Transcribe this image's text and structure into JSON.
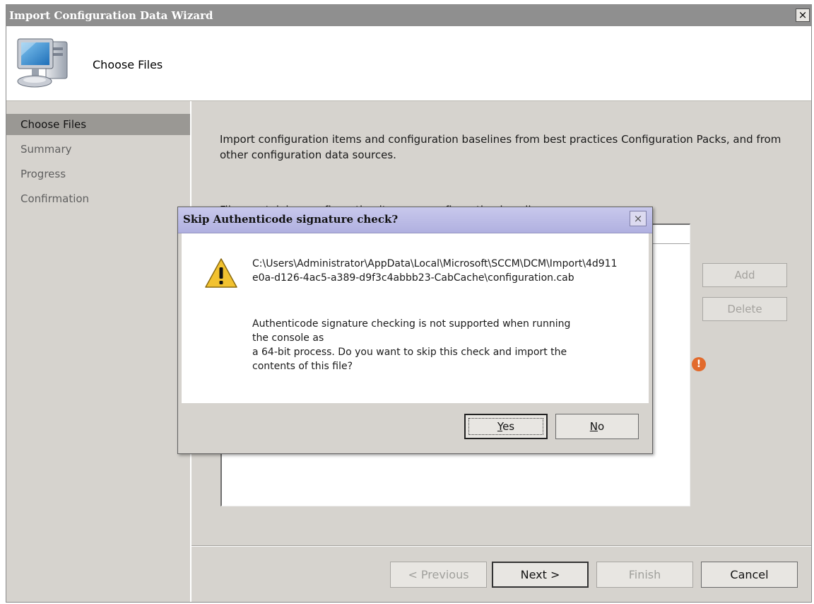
{
  "wizard": {
    "title": "Import Configuration Data Wizard",
    "close_glyph": "×",
    "header": {
      "title": "Choose Files",
      "icon": "computer-icon"
    },
    "nav": [
      {
        "label": "Choose Files",
        "active": true
      },
      {
        "label": "Summary",
        "active": false
      },
      {
        "label": "Progress",
        "active": false
      },
      {
        "label": "Confirmation",
        "active": false
      }
    ],
    "content": {
      "intro": "Import configuration items and configuration baselines from best practices Configuration Packs, and from other configuration data sources.",
      "files_label": "Files containing configuration items or configuration baselines:",
      "add_label": "Add",
      "delete_label": "Delete",
      "error_icon": "error-icon"
    },
    "footer": {
      "previous_label": "< Previous",
      "next_label": "Next >",
      "finish_label": "Finish",
      "cancel_label": "Cancel"
    }
  },
  "dialog": {
    "title": "Skip Authenticode signature check?",
    "close_glyph": "×",
    "icon": "warning-icon",
    "path": "C:\\Users\\Administrator\\AppData\\Local\\Microsoft\\SCCM\\DCM\\Import\\4d911e0a-d126-4ac5-a389-d9f3c4abbb23-CabCache\\configuration.cab",
    "message_lines": [
      "Authenticode signature checking is not supported when running",
      "the console as",
      "a 64-bit process. Do you want to skip this check and import the",
      "contents of this file?"
    ],
    "yes_mnemonic": "Y",
    "yes_rest": "es",
    "no_mnemonic": "N",
    "no_rest": "o"
  },
  "colors": {
    "face": "#d6d3ce",
    "titlebar": "#8f8f8f",
    "dialog_titlebar": "#b8b8e4",
    "warning": "#f2c230",
    "error": "#e26a2c"
  }
}
